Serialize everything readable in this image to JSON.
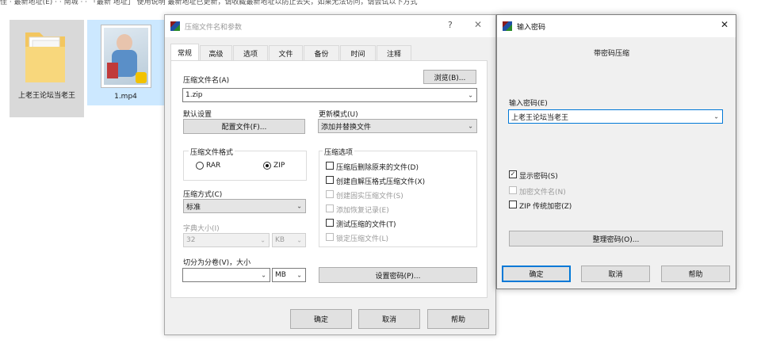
{
  "desktop": {
    "topbar_text": "佳  ·  最新地址(E)  ·  ·  南城 ·  ·  「最新 地址」 使用说明 最新地址已更新，请收藏最新地址以防止丢失，如果无法访问，请尝试以下方式",
    "items": [
      {
        "label": "上老王论坛当老王"
      },
      {
        "label": "1.mp4"
      }
    ]
  },
  "archive_dialog": {
    "title": "压缩文件名和参数",
    "help_btn": "?",
    "close_btn": "✕",
    "tabs": [
      "常规",
      "高级",
      "选项",
      "文件",
      "备份",
      "时间",
      "注释"
    ],
    "filename_label": "压缩文件名(A)",
    "browse_btn": "浏览(B)...",
    "filename_value": "1.zip",
    "default_label": "默认设置",
    "profile_btn": "配置文件(F)...",
    "update_label": "更新模式(U)",
    "update_value": "添加并替换文件",
    "format_group": "压缩文件格式",
    "formats": [
      "RAR",
      "ZIP"
    ],
    "format_selected": "ZIP",
    "options_group": "压缩选项",
    "options": [
      {
        "label": "压缩后删除原来的文件(D)",
        "checked": false,
        "disabled": false
      },
      {
        "label": "创建自解压格式压缩文件(X)",
        "checked": false,
        "disabled": false
      },
      {
        "label": "创建固实压缩文件(S)",
        "checked": false,
        "disabled": true
      },
      {
        "label": "添加恢复记录(E)",
        "checked": false,
        "disabled": true
      },
      {
        "label": "测试压缩的文件(T)",
        "checked": false,
        "disabled": false
      },
      {
        "label": "锁定压缩文件(L)",
        "checked": false,
        "disabled": true
      }
    ],
    "method_label": "压缩方式(C)",
    "method_value": "标准",
    "dict_label": "字典大小(I)",
    "dict_value": "32",
    "dict_unit": "KB",
    "split_label": "切分为分卷(V)，大小",
    "split_value": "",
    "split_unit": "MB",
    "set_password_btn": "设置密码(P)...",
    "ok_btn": "确定",
    "cancel_btn": "取消",
    "help_button": "帮助"
  },
  "password_dialog": {
    "title": "输入密码",
    "close_btn": "✕",
    "heading": "带密码压缩",
    "input_label": "输入密码(E)",
    "password_value": "上老王论坛当老王",
    "checkboxes": [
      {
        "label": "显示密码(S)",
        "checked": true,
        "disabled": false
      },
      {
        "label": "加密文件名(N)",
        "checked": false,
        "disabled": true
      },
      {
        "label": "ZIP 传统加密(Z)",
        "checked": false,
        "disabled": false
      }
    ],
    "organize_btn": "整理密码(O)...",
    "ok_btn": "确定",
    "cancel_btn": "取消",
    "help_btn": "帮助"
  },
  "colors": {
    "dialog_bg": "#f0f0f0",
    "selected_item_bg": "#cce8ff",
    "accent": "#0078d7"
  }
}
